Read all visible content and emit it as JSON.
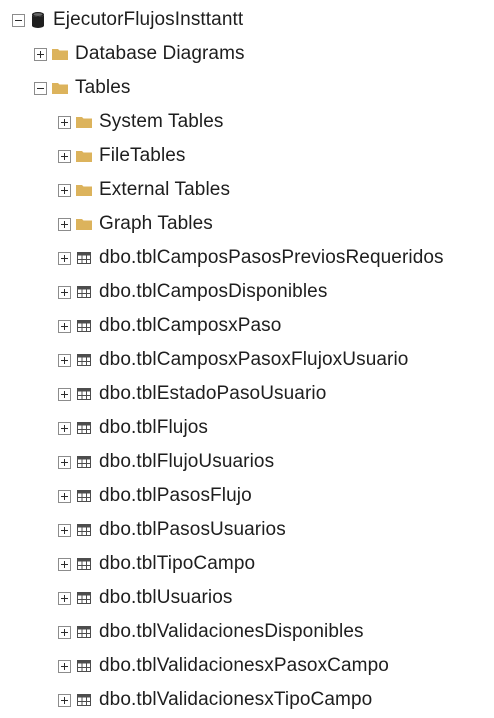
{
  "tree": {
    "root": {
      "label": "EjecutorFlujosInsttantt",
      "icon": "database-icon",
      "expanded": true
    },
    "database_diagrams": {
      "label": "Database Diagrams",
      "icon": "folder-icon",
      "expanded": false
    },
    "tables": {
      "label": "Tables",
      "icon": "folder-icon",
      "expanded": true,
      "folders": [
        {
          "label": "System Tables",
          "icon": "folder-icon"
        },
        {
          "label": "FileTables",
          "icon": "folder-icon"
        },
        {
          "label": "External Tables",
          "icon": "folder-icon"
        },
        {
          "label": "Graph Tables",
          "icon": "folder-icon"
        }
      ],
      "items": [
        {
          "label": "dbo.tblCamposPasosPreviosRequeridos",
          "icon": "table-icon"
        },
        {
          "label": "dbo.tblCamposDisponibles",
          "icon": "table-icon"
        },
        {
          "label": "dbo.tblCamposxPaso",
          "icon": "table-icon"
        },
        {
          "label": "dbo.tblCamposxPasoxFlujoxUsuario",
          "icon": "table-icon"
        },
        {
          "label": "dbo.tblEstadoPasoUsuario",
          "icon": "table-icon"
        },
        {
          "label": "dbo.tblFlujos",
          "icon": "table-icon"
        },
        {
          "label": "dbo.tblFlujoUsuarios",
          "icon": "table-icon"
        },
        {
          "label": "dbo.tblPasosFlujo",
          "icon": "table-icon"
        },
        {
          "label": "dbo.tblPasosUsuarios",
          "icon": "table-icon"
        },
        {
          "label": "dbo.tblTipoCampo",
          "icon": "table-icon"
        },
        {
          "label": "dbo.tblUsuarios",
          "icon": "table-icon"
        },
        {
          "label": "dbo.tblValidacionesDisponibles",
          "icon": "table-icon"
        },
        {
          "label": "dbo.tblValidacionesxPasoxCampo",
          "icon": "table-icon"
        },
        {
          "label": "dbo.tblValidacionesxTipoCampo",
          "icon": "table-icon"
        }
      ]
    }
  },
  "colors": {
    "folder": "#dcb35c",
    "database": "#1f1f1f",
    "table_border": "#4d4d4d",
    "text": "#1e1e1e"
  }
}
